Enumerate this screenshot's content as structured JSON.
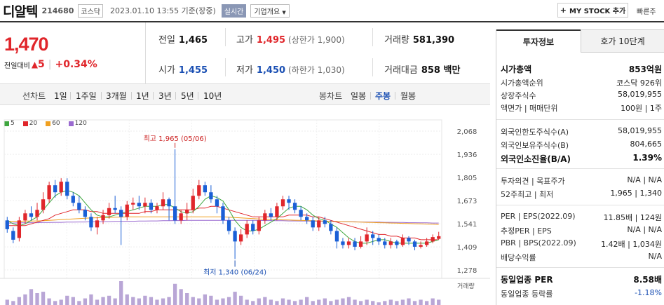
{
  "header": {
    "name": "디알텍",
    "code": "214680",
    "market": "코스닥",
    "timestamp": "2023.01.10 13:55 기준(장중)",
    "realtime": "실시간",
    "company_info": "기업개요",
    "mystock": "MY STOCK 추가",
    "quick": "빠른주"
  },
  "price": {
    "current": "1,470",
    "change_label": "전일대비",
    "change_amount": "5",
    "change_pct": "+0.34%"
  },
  "stats": {
    "prev_label": "전일",
    "prev": "1,465",
    "high_label": "고가",
    "high": "1,495",
    "upper_limit": "(상한가 1,900)",
    "volume_label": "거래량",
    "volume": "581,390",
    "open_label": "시가",
    "open": "1,455",
    "low_label": "저가",
    "low": "1,450",
    "lower_limit": "(하한가 1,030)",
    "amount_label": "거래대금",
    "amount": "858 백만"
  },
  "chart_tabs": {
    "line_label": "선차트",
    "line_periods": [
      "1일",
      "1주일",
      "3개월",
      "1년",
      "3년",
      "5년",
      "10년"
    ],
    "candle_label": "봉차트",
    "candle_periods": [
      "일봉",
      "주봉",
      "월봉"
    ],
    "active_candle": "주봉"
  },
  "chart_data": {
    "type": "candlestick",
    "legend": [
      "5",
      "20",
      "60",
      "120"
    ],
    "legend_colors": [
      "#3fa63f",
      "#e0262b",
      "#f0a020",
      "#9a6ad0"
    ],
    "y_ticks": [
      2068,
      1936,
      1805,
      1673,
      1541,
      1409,
      1278
    ],
    "ylim": [
      1278,
      2068
    ],
    "high_annotation": "최고 1,965 (05/06)",
    "low_annotation": "최저 1,340 (06/24)",
    "volume_label": "거래량",
    "candles": [
      [
        1560,
        1510,
        1580,
        1490
      ],
      [
        1500,
        1450,
        1520,
        1430
      ],
      [
        1460,
        1560,
        1580,
        1440
      ],
      [
        1560,
        1600,
        1620,
        1540
      ],
      [
        1600,
        1580,
        1640,
        1560
      ],
      [
        1580,
        1620,
        1660,
        1560
      ],
      [
        1620,
        1680,
        1720,
        1600
      ],
      [
        1680,
        1760,
        1780,
        1660
      ],
      [
        1760,
        1720,
        1790,
        1690
      ],
      [
        1720,
        1780,
        1800,
        1700
      ],
      [
        1780,
        1700,
        1800,
        1680
      ],
      [
        1700,
        1660,
        1720,
        1640
      ],
      [
        1660,
        1620,
        1700,
        1600
      ],
      [
        1620,
        1580,
        1640,
        1560
      ],
      [
        1580,
        1520,
        1600,
        1500
      ],
      [
        1520,
        1560,
        1580,
        1480
      ],
      [
        1560,
        1590,
        1620,
        1540
      ],
      [
        1590,
        1630,
        1660,
        1570
      ],
      [
        1630,
        1620,
        1700,
        1600
      ],
      [
        1620,
        1580,
        1640,
        1420
      ],
      [
        1580,
        1650,
        1670,
        1560
      ],
      [
        1650,
        1660,
        1690,
        1620
      ],
      [
        1660,
        1640,
        1700,
        1620
      ],
      [
        1640,
        1660,
        1690,
        1600
      ],
      [
        1660,
        1620,
        1680,
        1600
      ],
      [
        1620,
        1640,
        1660,
        1600
      ],
      [
        1640,
        1680,
        1720,
        1620
      ],
      [
        1680,
        1640,
        1690,
        1560
      ],
      [
        1640,
        1560,
        1965,
        1540
      ],
      [
        1560,
        1600,
        1620,
        1540
      ],
      [
        1600,
        1620,
        1660,
        1560
      ],
      [
        1620,
        1700,
        1740,
        1600
      ],
      [
        1700,
        1760,
        1790,
        1680
      ],
      [
        1760,
        1720,
        1780,
        1700
      ],
      [
        1720,
        1680,
        1760,
        1660
      ],
      [
        1680,
        1640,
        1700,
        1600
      ],
      [
        1640,
        1560,
        1660,
        1540
      ],
      [
        1560,
        1500,
        1580,
        1480
      ],
      [
        1500,
        1440,
        1520,
        1340
      ],
      [
        1440,
        1480,
        1510,
        1420
      ],
      [
        1480,
        1540,
        1560,
        1460
      ],
      [
        1540,
        1500,
        1560,
        1480
      ],
      [
        1500,
        1560,
        1580,
        1480
      ],
      [
        1560,
        1600,
        1620,
        1540
      ],
      [
        1600,
        1580,
        1630,
        1560
      ],
      [
        1580,
        1640,
        1660,
        1560
      ],
      [
        1640,
        1680,
        1700,
        1620
      ],
      [
        1680,
        1660,
        1700,
        1620
      ],
      [
        1660,
        1620,
        1680,
        1600
      ],
      [
        1620,
        1580,
        1640,
        1560
      ],
      [
        1580,
        1560,
        1600,
        1540
      ],
      [
        1560,
        1520,
        1580,
        1500
      ],
      [
        1520,
        1560,
        1580,
        1500
      ],
      [
        1560,
        1540,
        1580,
        1520
      ],
      [
        1540,
        1500,
        1560,
        1480
      ],
      [
        1500,
        1440,
        1520,
        1400
      ],
      [
        1440,
        1420,
        1460,
        1400
      ],
      [
        1420,
        1440,
        1460,
        1400
      ],
      [
        1440,
        1410,
        1460,
        1390
      ],
      [
        1410,
        1440,
        1470,
        1400
      ],
      [
        1440,
        1480,
        1520,
        1420
      ],
      [
        1480,
        1460,
        1500,
        1420
      ],
      [
        1460,
        1440,
        1480,
        1420
      ],
      [
        1440,
        1420,
        1460,
        1400
      ],
      [
        1420,
        1440,
        1460,
        1400
      ],
      [
        1440,
        1420,
        1450,
        1400
      ],
      [
        1420,
        1460,
        1480,
        1410
      ],
      [
        1460,
        1440,
        1470,
        1420
      ],
      [
        1440,
        1410,
        1450,
        1390
      ],
      [
        1410,
        1420,
        1440,
        1400
      ],
      [
        1420,
        1440,
        1460,
        1410
      ],
      [
        1440,
        1465,
        1480,
        1430
      ],
      [
        1455,
        1470,
        1495,
        1450
      ]
    ],
    "ma5": [
      1560,
      1540,
      1530,
      1540,
      1560,
      1580,
      1620,
      1660,
      1700,
      1720,
      1730,
      1720,
      1700,
      1660,
      1620,
      1590,
      1580,
      1580,
      1590,
      1600,
      1610,
      1620,
      1630,
      1640,
      1640,
      1640,
      1650,
      1650,
      1630,
      1610,
      1600,
      1610,
      1640,
      1680,
      1700,
      1690,
      1670,
      1620,
      1560,
      1520,
      1500,
      1500,
      1510,
      1530,
      1550,
      1570,
      1600,
      1630,
      1640,
      1640,
      1620,
      1590,
      1570,
      1560,
      1540,
      1520,
      1490,
      1460,
      1440,
      1430,
      1430,
      1440,
      1450,
      1450,
      1440,
      1430,
      1430,
      1430,
      1430,
      1430,
      1430,
      1440,
      1450
    ],
    "ma20": [
      1530,
      1530,
      1530,
      1530,
      1540,
      1550,
      1560,
      1570,
      1590,
      1600,
      1610,
      1620,
      1620,
      1620,
      1610,
      1610,
      1600,
      1600,
      1600,
      1600,
      1600,
      1600,
      1600,
      1610,
      1610,
      1620,
      1620,
      1620,
      1620,
      1620,
      1620,
      1620,
      1630,
      1630,
      1640,
      1640,
      1630,
      1620,
      1610,
      1600,
      1590,
      1580,
      1580,
      1580,
      1580,
      1580,
      1580,
      1590,
      1590,
      1590,
      1590,
      1580,
      1580,
      1570,
      1560,
      1550,
      1540,
      1530,
      1520,
      1510,
      1500,
      1490,
      1480,
      1480,
      1470,
      1470,
      1460,
      1460,
      1460,
      1450,
      1450,
      1450,
      1450
    ],
    "ma60": [
      1555,
      1555,
      1555,
      1556,
      1556,
      1557,
      1558,
      1560,
      1562,
      1564,
      1566,
      1568,
      1570,
      1572,
      1574,
      1575,
      1576,
      1577,
      1578,
      1579,
      1580,
      1580,
      1580,
      1580,
      1580,
      1580,
      1580,
      1580,
      1580,
      1580,
      1580,
      1580,
      1580,
      1580,
      1580,
      1580,
      1580,
      1578,
      1576,
      1574,
      1572,
      1570,
      1568,
      1566,
      1565,
      1564,
      1563,
      1562,
      1561,
      1560,
      1559,
      1558,
      1557,
      1556,
      1555,
      1554,
      1553,
      1552,
      1551,
      1550,
      1549,
      1548,
      1547,
      1546,
      1545,
      1544,
      1543,
      1542,
      1541,
      1540,
      1539,
      1538,
      1537
    ],
    "ma120": [
      1545,
      1545,
      1546,
      1546,
      1547,
      1547,
      1548,
      1548,
      1549,
      1549,
      1550,
      1550,
      1551,
      1551,
      1552,
      1552,
      1553,
      1553,
      1554,
      1554,
      1555,
      1555,
      1556,
      1556,
      1557,
      1557,
      1558,
      1558,
      1559,
      1559,
      1560,
      1560,
      1560,
      1560,
      1560,
      1560,
      1560,
      1560,
      1560,
      1560,
      1560,
      1560,
      1560,
      1559,
      1559,
      1558,
      1558,
      1557,
      1557,
      1556,
      1556,
      1555,
      1555,
      1554,
      1554,
      1553,
      1553,
      1552,
      1552,
      1551,
      1551,
      1550,
      1550,
      1549,
      1549,
      1548,
      1548,
      1547,
      1547,
      1546,
      1546,
      1545,
      1545
    ],
    "volumes": [
      20,
      15,
      30,
      40,
      60,
      45,
      50,
      25,
      15,
      20,
      35,
      30,
      15,
      25,
      40,
      20,
      30,
      35,
      25,
      90,
      40,
      30,
      25,
      35,
      30,
      20,
      25,
      30,
      80,
      60,
      45,
      30,
      25,
      40,
      35,
      20,
      25,
      30,
      50,
      35,
      20,
      15,
      25,
      30,
      20,
      15,
      25,
      20,
      15,
      20,
      30,
      15,
      20,
      25,
      15,
      20,
      25,
      30,
      20,
      15,
      20,
      15,
      10,
      15,
      20,
      15,
      20,
      25,
      15,
      20,
      15,
      25,
      20
    ]
  },
  "right_panel": {
    "tab_active": "투자정보",
    "tab_inactive": "호가 10단계",
    "rows": [
      {
        "l": "시가총액",
        "r": "853억원",
        "bold": true
      },
      {
        "l": "시가총액순위",
        "r": "코스닥 926위"
      },
      {
        "l": "상장주식수",
        "r": "58,019,955"
      },
      {
        "l": "액면가 | 매매단위",
        "r": "100원 | 1주"
      },
      {
        "l": "외국인한도주식수(A)",
        "r": "58,019,955"
      },
      {
        "l": "외국인보유주식수(B)",
        "r": "804,665"
      },
      {
        "l": "외국인소진율(B/A)",
        "r": "1.39%",
        "bold": true
      },
      {
        "l": "투자의견 | 목표주가",
        "r": "N/A | N/A"
      },
      {
        "l": "52주최고 | 최저",
        "r": "1,965 | 1,340"
      },
      {
        "l": "PER | EPS(2022.09)",
        "r": "11.85배 | 124원"
      },
      {
        "l": "추정PER | EPS",
        "r": "N/A | N/A"
      },
      {
        "l": "PBR | BPS(2022.09)",
        "r": "1.42배 | 1,034원"
      },
      {
        "l": "배당수익률",
        "r": "N/A"
      },
      {
        "l": "동일업종 PER",
        "r": "8.58배",
        "bold": true
      },
      {
        "l": "동일업종 등락률",
        "r": "-1.18%"
      }
    ]
  }
}
